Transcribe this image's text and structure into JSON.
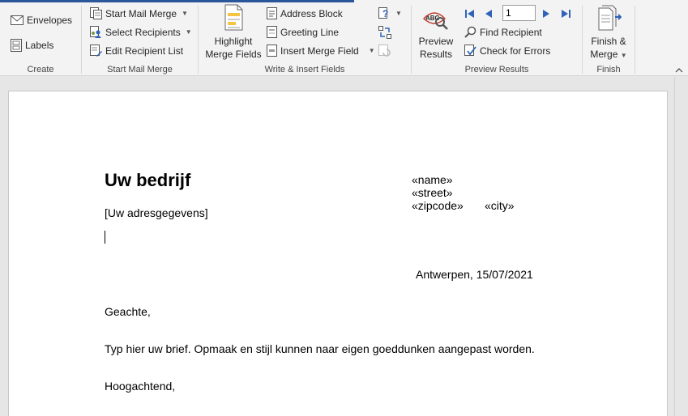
{
  "ribbon": {
    "create": {
      "label": "Create",
      "envelopes": "Envelopes",
      "labels": "Labels"
    },
    "start_mail_merge": {
      "label": "Start Mail Merge",
      "start": "Start Mail Merge",
      "select_recipients": "Select Recipients",
      "edit_list": "Edit Recipient List"
    },
    "write_insert": {
      "label": "Write & Insert Fields",
      "highlight_line1": "Highlight",
      "highlight_line2": "Merge Fields",
      "address_block": "Address Block",
      "greeting_line": "Greeting Line",
      "insert_merge_field": "Insert Merge Field"
    },
    "preview": {
      "label": "Preview Results",
      "preview_line1": "Preview",
      "preview_line2": "Results",
      "record": "1",
      "find_recipient": "Find Recipient",
      "check_errors": "Check for Errors"
    },
    "finish": {
      "label": "Finish",
      "line1": "Finish &",
      "line2": "Merge"
    }
  },
  "document": {
    "company": "Uw bedrijf",
    "address": "[Uw adresgegevens]",
    "field_name": "«name»",
    "field_street": "«street»",
    "field_zipcode": "«zipcode»",
    "field_city": "«city»",
    "date_line": "Antwerpen, 15/07/2021",
    "salutation": "Geachte,",
    "body": "Typ hier uw brief. Opmaak en stijl kunnen naar eigen goeddunken aangepast worden.",
    "closing": "Hoogachtend,"
  },
  "colors": {
    "accent": "#2b579a",
    "nav_blue": "#2e63b8",
    "ribbon_bg": "#f3f3f3"
  }
}
